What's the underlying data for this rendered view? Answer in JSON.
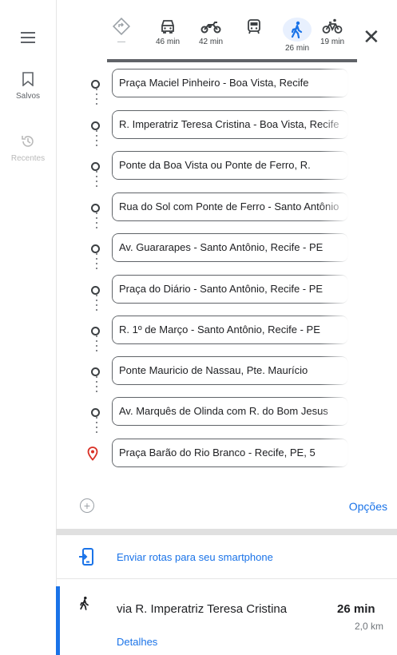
{
  "rail": {
    "menu_icon": "menu-icon",
    "saved": {
      "label": "Salvos",
      "icon": "bookmark-icon"
    },
    "recent": {
      "label": "Recentes",
      "icon": "history-icon"
    }
  },
  "modes": [
    {
      "name": "best",
      "time": "—"
    },
    {
      "name": "drive",
      "time": "46 min"
    },
    {
      "name": "motorcycle",
      "time": "42 min"
    },
    {
      "name": "transit",
      "time": ""
    },
    {
      "name": "walk",
      "time": "26 min",
      "active": true
    },
    {
      "name": "bike",
      "time": "19 min"
    }
  ],
  "close_label": "✕",
  "waypoints": [
    "Praça Maciel Pinheiro - Boa Vista, Recife",
    "R. Imperatriz Teresa Cristina - Boa Vista, Recife",
    "Ponte da Boa Vista ou Ponte de Ferro, R.",
    "Rua do Sol com Ponte de Ferro - Santo Antônio",
    "Av. Guararapes - Santo Antônio, Recife - PE",
    "Praça do Diário - Santo Antônio, Recife - PE",
    "R. 1º de Março - Santo Antônio, Recife - PE",
    "Ponte Mauricio de Nassau, Pte. Maurício",
    "Av. Marquês de Olinda com R. do Bom Jesus",
    "Praça Barão do Rio Branco - Recife, PE, 5"
  ],
  "options_label": "Opções",
  "send_label": "Enviar rotas para seu smartphone",
  "route": {
    "title": "via R. Imperatriz Teresa Cristina",
    "time": "26 min",
    "distance": "2,0 km",
    "details_label": "Detalhes"
  },
  "colors": {
    "accent": "#1a73e8",
    "destination": "#d93025"
  }
}
